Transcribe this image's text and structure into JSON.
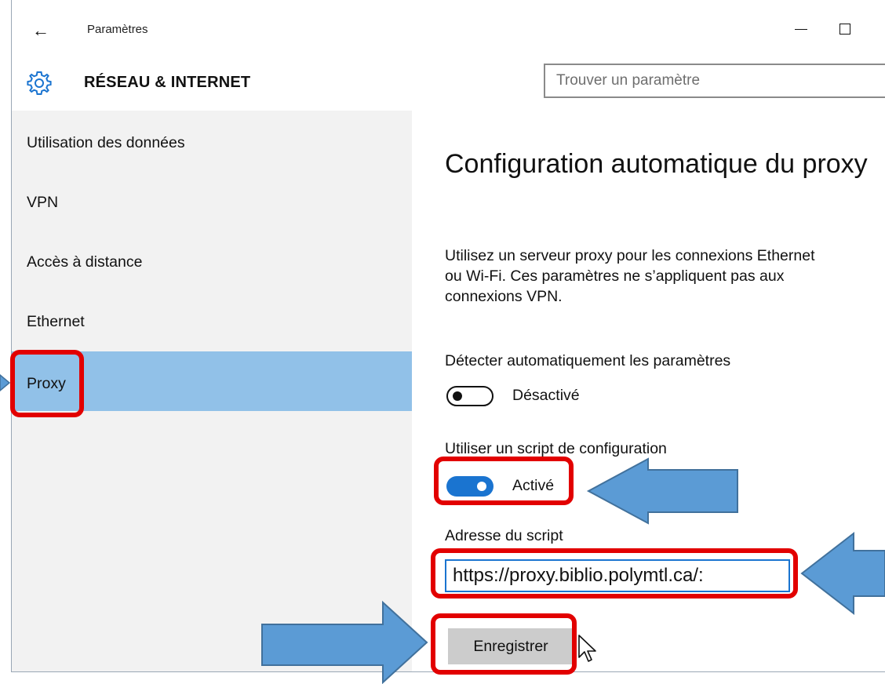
{
  "window": {
    "title": "Paramètres"
  },
  "header": {
    "section_title": "RÉSEAU & INTERNET",
    "search_placeholder": "Trouver un paramètre"
  },
  "sidebar": {
    "items": [
      {
        "label": "Utilisation des données",
        "selected": false
      },
      {
        "label": "VPN",
        "selected": false
      },
      {
        "label": "Accès à distance",
        "selected": false
      },
      {
        "label": "Ethernet",
        "selected": false
      },
      {
        "label": "Proxy",
        "selected": true
      }
    ]
  },
  "content": {
    "heading": "Configuration automatique du proxy",
    "description": "Utilisez un serveur proxy pour les connexions Ethernet\nou Wi-Fi. Ces paramètres ne s’appliquent pas aux\nconnexions VPN.",
    "auto_detect": {
      "label": "Détecter automatiquement les paramètres",
      "state": "Désactivé",
      "on": false
    },
    "use_script": {
      "label": "Utiliser un script de configuration",
      "state": "Activé",
      "on": true
    },
    "script_address": {
      "label": "Adresse du script",
      "value": "https://proxy.biblio.polymtl.ca/:"
    },
    "save_label": "Enregistrer"
  },
  "colors": {
    "selection": "#91c1e8",
    "accent": "#1a74d0",
    "highlight": "#e20000",
    "arrow": "#5b9bd5"
  },
  "icons": [
    "back-arrow-icon",
    "minimize-icon",
    "maximize-icon",
    "gear-icon",
    "mouse-cursor-icon",
    "annotation-arrow"
  ]
}
